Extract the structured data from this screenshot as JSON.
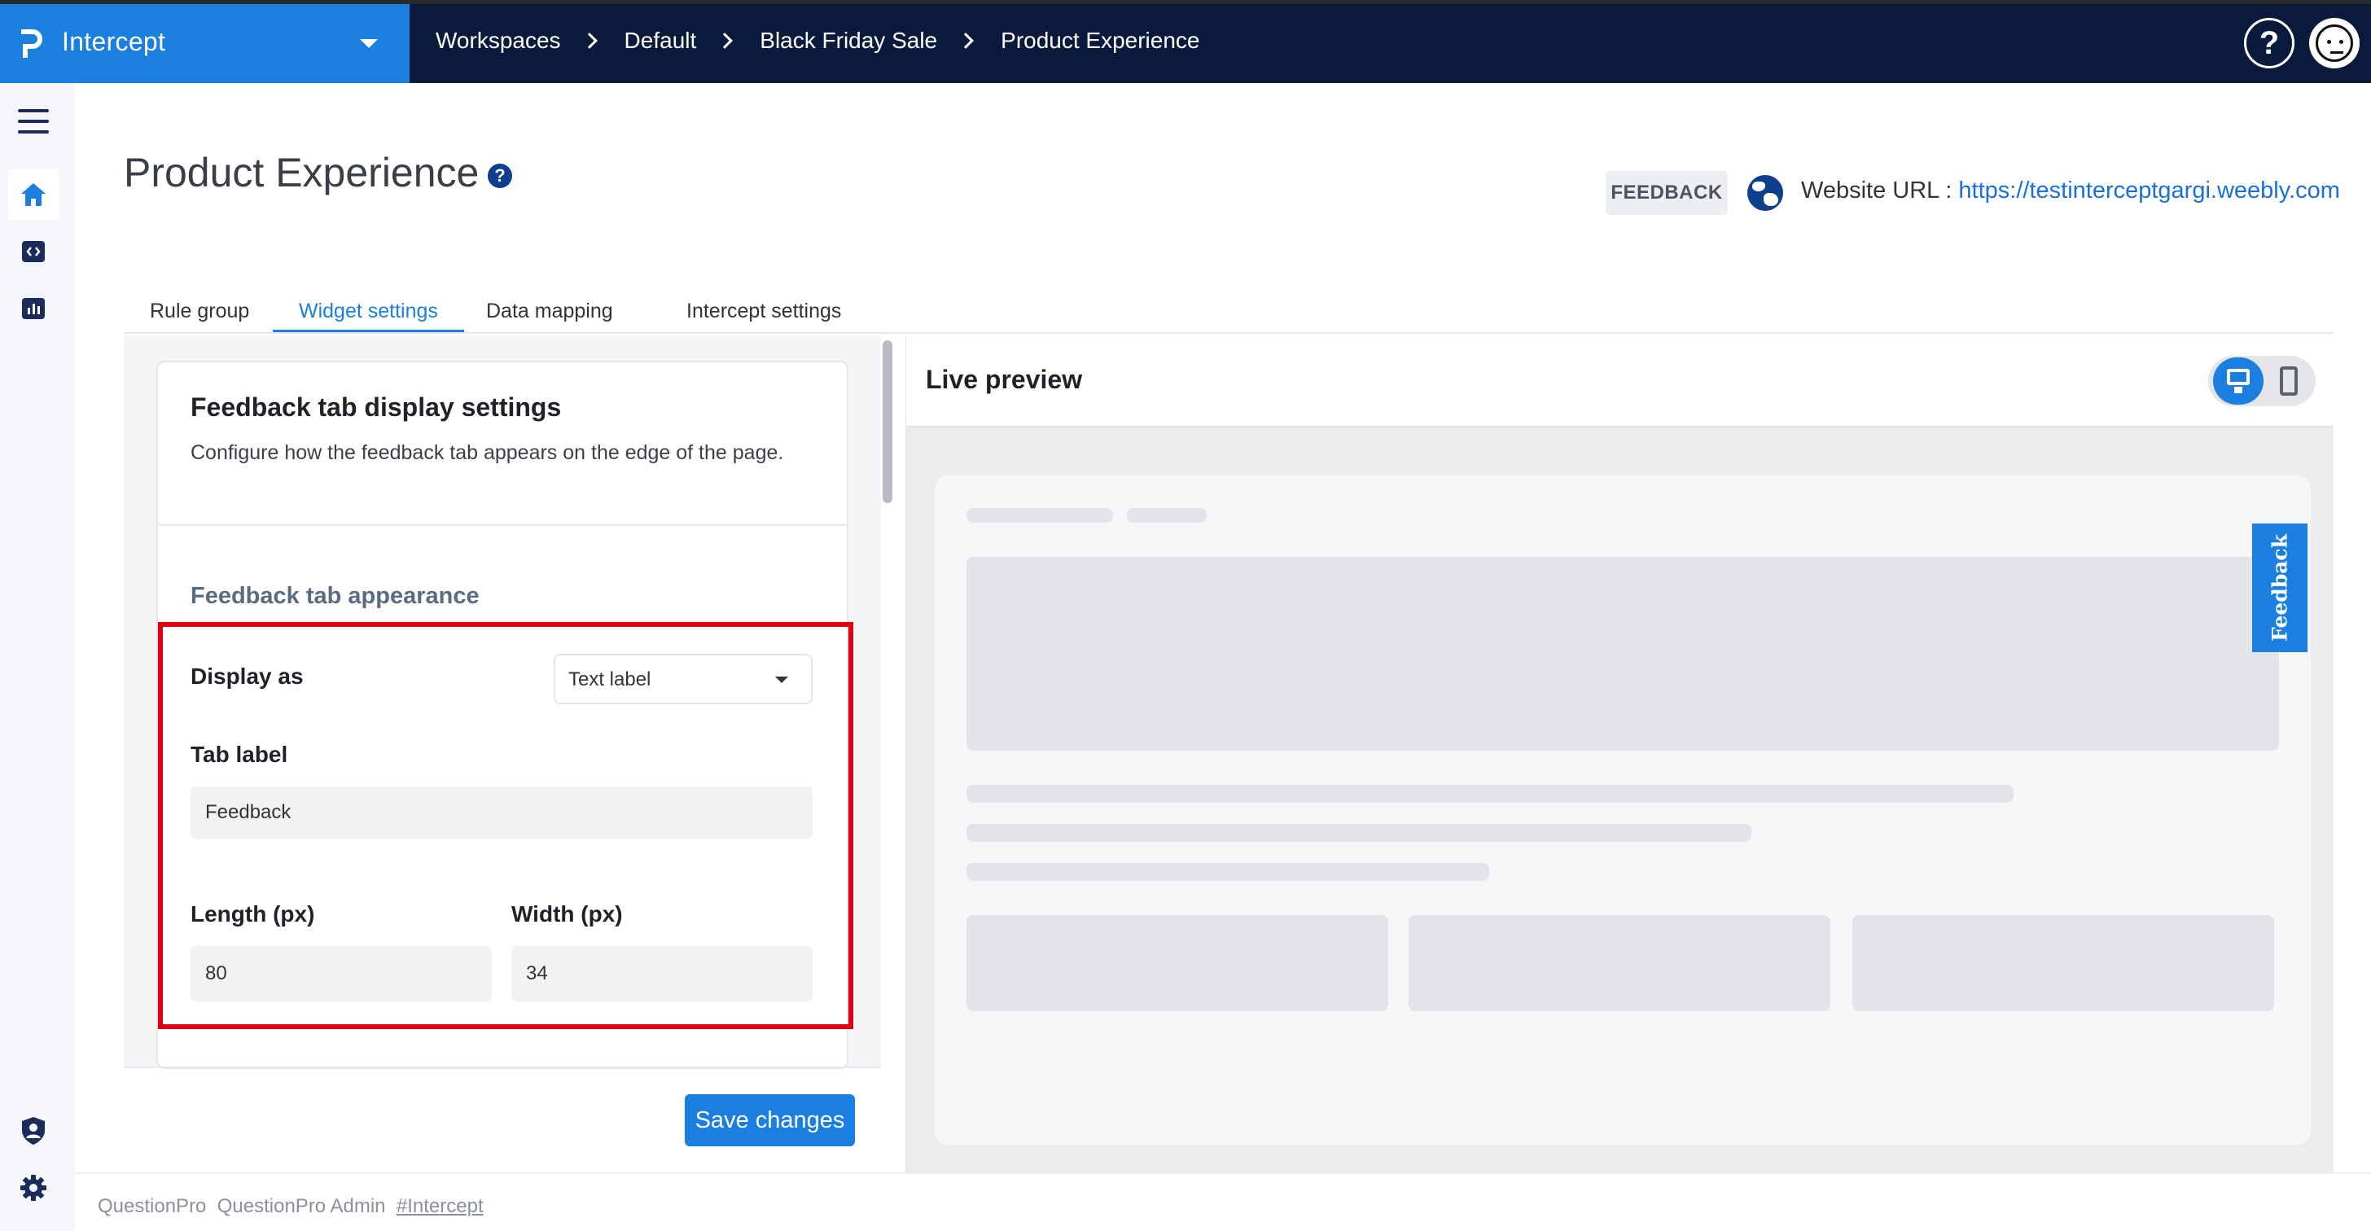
{
  "app": {
    "brand_name": "Intercept",
    "accent_color": "#1b7fe0",
    "topbar_color": "#0a1a3d"
  },
  "breadcrumb": [
    "Workspaces",
    "Default",
    "Black Friday Sale",
    "Product Experience"
  ],
  "topbar": {
    "help_label": "?"
  },
  "left_rail": [
    {
      "icon": "hamburger-menu-icon"
    },
    {
      "icon": "home-icon",
      "active": true
    },
    {
      "icon": "code-embed-icon"
    },
    {
      "icon": "bar-chart-icon"
    },
    {
      "icon": "user-shield-icon"
    },
    {
      "icon": "settings-gear-icon"
    }
  ],
  "header": {
    "title": "Product Experience",
    "help_label": "?",
    "type_chip": "FEEDBACK",
    "website_label": "Website URL : ",
    "website_url": "https://testinterceptgargi.weebly.com"
  },
  "tabs": [
    {
      "label": "Rule group",
      "active": false
    },
    {
      "label": "Widget settings",
      "active": true
    },
    {
      "label": "Data mapping",
      "active": false
    },
    {
      "label": "Intercept settings",
      "active": false
    }
  ],
  "settings": {
    "card_title": "Feedback tab display settings",
    "card_description": "Configure how the feedback tab appears on the edge of the page.",
    "section_label": "Feedback tab appearance",
    "display_as_label": "Display as",
    "display_as_value": "Text label",
    "tab_label_label": "Tab label",
    "tab_label_value": "Feedback",
    "length_label": "Length (px)",
    "length_value": "80",
    "width_label": "Width (px)",
    "width_value": "34",
    "save_label": "Save changes"
  },
  "preview": {
    "title": "Live preview",
    "feedback_tab_text": "Feedback",
    "device_mode": "desktop"
  },
  "footer": {
    "org": "QuestionPro",
    "user": "QuestionPro Admin",
    "tag": "#Intercept"
  }
}
